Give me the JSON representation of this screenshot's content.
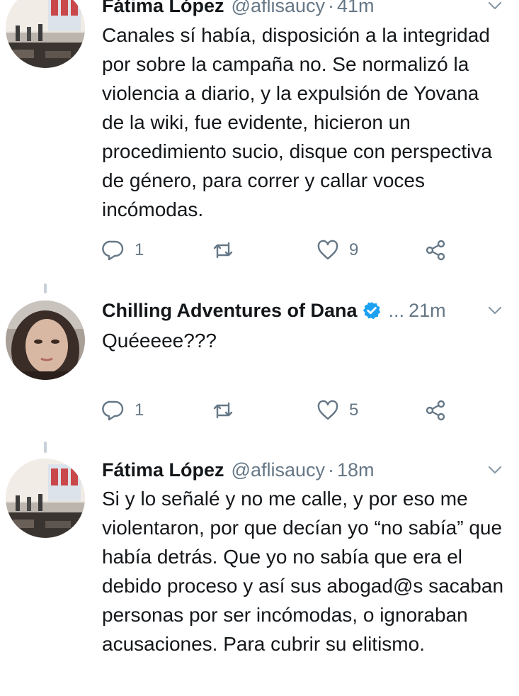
{
  "tweets": [
    {
      "name": "Fátima López",
      "handle": "@aflisaucy",
      "time": "41m",
      "text": "Canales sí había,  disposición a la integridad por sobre la campaña no.  Se normalizó la violencia a diario,  y la expulsión de Yovana de la wiki, fue evidente, hicieron un procedimiento sucio, disque con perspectiva de género, para correr y callar voces incómodas.",
      "replies": "1",
      "likes": "9"
    },
    {
      "name": "Chilling Adventures of Dana",
      "handle": "...",
      "time": "21m",
      "verified": true,
      "text": "Quéeeee???",
      "replies": "1",
      "likes": "5"
    },
    {
      "name": "Fátima López",
      "handle": "@aflisaucy",
      "time": "18m",
      "text": "Si y lo señalé y no me calle, y por eso me violentaron, por que decían yo “no sabía” que había detrás. Que yo no sabía que era el debido proceso y así sus abogad@s sacaban personas por ser incómodas, o ignoraban acusaciones. Para cubrir su elitismo."
    }
  ],
  "colors": {
    "text": "#14171a",
    "muted": "#657786",
    "verified": "#1da1f2",
    "thread": "#c8d1d9"
  },
  "icons": [
    "reply-icon",
    "retweet-icon",
    "like-icon",
    "share-icon",
    "verified-icon",
    "chevron-down-icon"
  ]
}
